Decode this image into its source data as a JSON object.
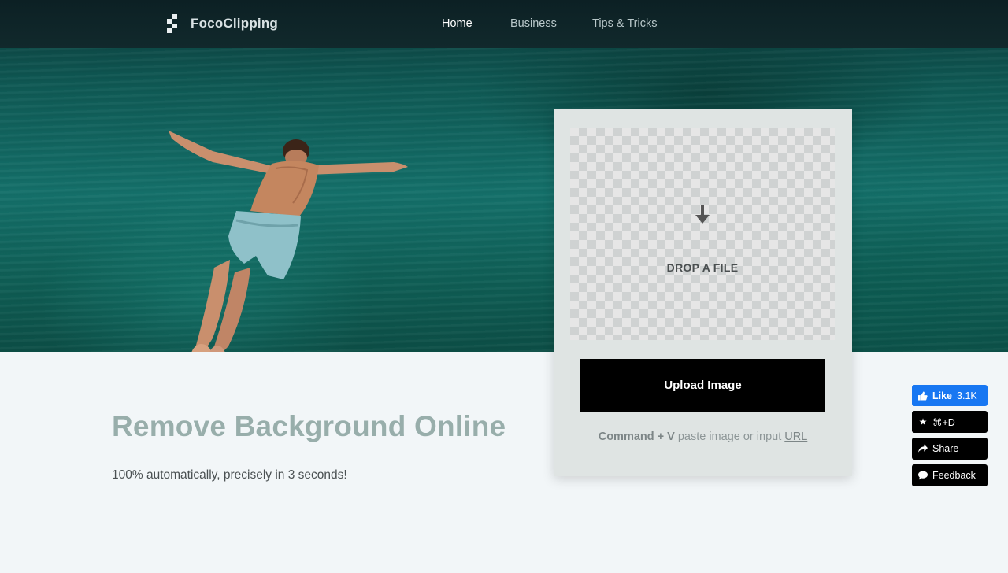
{
  "header": {
    "logo_text": "FocoClipping",
    "nav": [
      {
        "label": "Home",
        "active": true
      },
      {
        "label": "Business",
        "active": false
      },
      {
        "label": "Tips & Tricks",
        "active": false
      }
    ]
  },
  "upload": {
    "drop_label": "DROP A FILE",
    "button_label": "Upload Image",
    "hint_kbd": "Command + V",
    "hint_text": " paste image or input ",
    "hint_link": "URL"
  },
  "hero_text": {
    "headline": "Remove Background Online",
    "subhead": "100% automatically, precisely in 3 seconds!"
  },
  "side_widgets": {
    "like": {
      "label": "Like",
      "count": "3.1K",
      "icon": "thumbs-up-icon"
    },
    "bookmark": {
      "label": "⌘+D",
      "icon": "star-icon"
    },
    "share": {
      "label": "Share",
      "icon": "share-arrow-icon"
    },
    "feedback": {
      "label": "Feedback",
      "icon": "speech-bubble-icon"
    }
  },
  "colors": {
    "navbar": "#11292c",
    "upload_button": "#000000",
    "headline": "#98aeab",
    "like_button": "#1877f2"
  }
}
